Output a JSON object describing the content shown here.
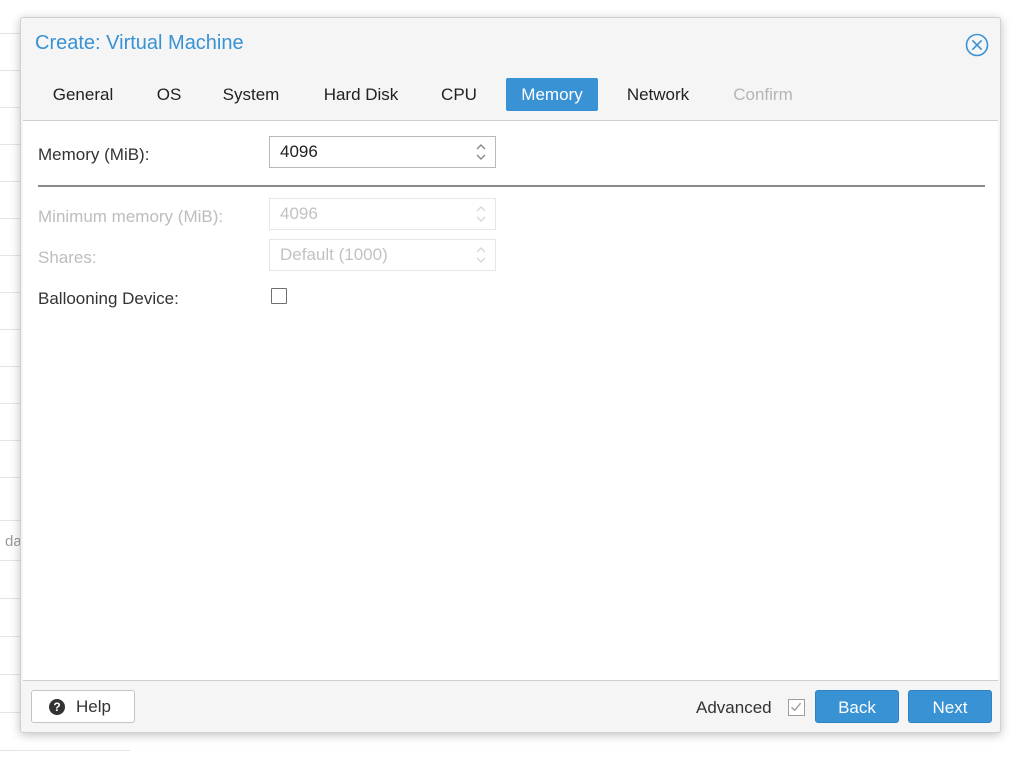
{
  "window": {
    "title": "Create: Virtual Machine"
  },
  "tabs": [
    {
      "label": "General",
      "state": "normal"
    },
    {
      "label": "OS",
      "state": "normal"
    },
    {
      "label": "System",
      "state": "normal"
    },
    {
      "label": "Hard Disk",
      "state": "normal"
    },
    {
      "label": "CPU",
      "state": "normal"
    },
    {
      "label": "Memory",
      "state": "active"
    },
    {
      "label": "Network",
      "state": "normal"
    },
    {
      "label": "Confirm",
      "state": "disabled"
    }
  ],
  "form": {
    "memory": {
      "label": "Memory (MiB):",
      "value": "4096"
    },
    "min_memory": {
      "label": "Minimum memory (MiB):",
      "value": "4096",
      "disabled": true
    },
    "shares": {
      "label": "Shares:",
      "value": "Default (1000)",
      "disabled": true
    },
    "ballooning": {
      "label": "Ballooning Device:",
      "checked": false
    }
  },
  "footer": {
    "help_label": "Help",
    "advanced_label": "Advanced",
    "advanced_checked": true,
    "back_label": "Back",
    "next_label": "Next"
  },
  "background": {
    "partial_text": "da"
  },
  "colors": {
    "accent": "#3892d4",
    "disabled_text": "#bdbdbd"
  },
  "icons": {
    "close": "close-circle-icon",
    "help": "question-circle-icon",
    "spinner": "spinner-arrows-icon",
    "check": "checkmark-icon"
  }
}
